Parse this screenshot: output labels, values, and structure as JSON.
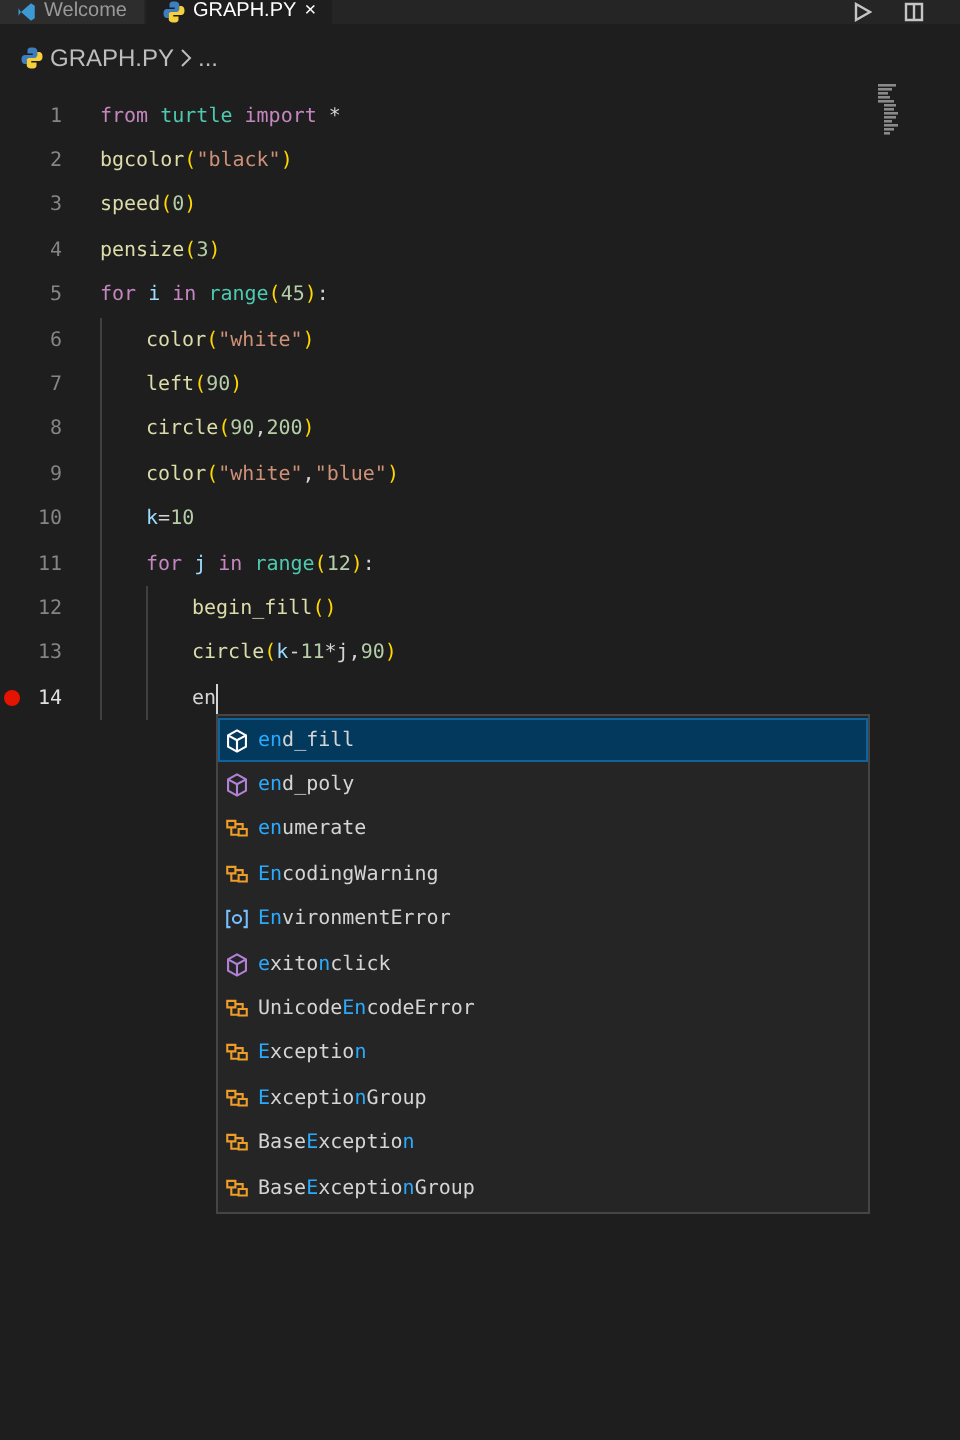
{
  "tabs": [
    {
      "label": "Welcome",
      "selected": false,
      "kind": "welcome"
    },
    {
      "label": "GRAPH.PY",
      "selected": true,
      "kind": "python",
      "close": "×"
    }
  ],
  "breadcrumb": {
    "file": "GRAPH.PY",
    "rest": "..."
  },
  "editor": {
    "lines": [
      {
        "number": "1",
        "breakpoint": false,
        "current": false,
        "tokens": [
          {
            "text": "from",
            "kind": "keyword"
          },
          {
            "text": " turtle",
            "kind": "module"
          },
          {
            "text": " import",
            "kind": "keyword"
          },
          {
            "text": " *",
            "kind": "plain"
          }
        ]
      },
      {
        "number": "2",
        "breakpoint": false,
        "current": false,
        "tokens": [
          {
            "text": "bgcolor",
            "kind": "function"
          },
          {
            "text": "(",
            "kind": "bracket"
          },
          {
            "text": "\"black\"",
            "kind": "string"
          },
          {
            "text": ")",
            "kind": "bracket"
          }
        ]
      },
      {
        "number": "3",
        "breakpoint": false,
        "current": false,
        "tokens": [
          {
            "text": "speed",
            "kind": "function"
          },
          {
            "text": "(",
            "kind": "bracket"
          },
          {
            "text": "0",
            "kind": "number"
          },
          {
            "text": ")",
            "kind": "bracket"
          }
        ]
      },
      {
        "number": "4",
        "breakpoint": false,
        "current": false,
        "tokens": [
          {
            "text": "pensize",
            "kind": "function"
          },
          {
            "text": "(",
            "kind": "bracket"
          },
          {
            "text": "3",
            "kind": "number"
          },
          {
            "text": ")",
            "kind": "bracket"
          }
        ]
      },
      {
        "number": "5",
        "breakpoint": false,
        "current": false,
        "tokens": [
          {
            "text": "for",
            "kind": "keyword"
          },
          {
            "text": " i",
            "kind": "variable"
          },
          {
            "text": " in",
            "kind": "keyword"
          },
          {
            "text": " range",
            "kind": "module"
          },
          {
            "text": "(",
            "kind": "bracket"
          },
          {
            "text": "45",
            "kind": "number"
          },
          {
            "text": ")",
            "kind": "bracket"
          },
          {
            "text": ":",
            "kind": "plain"
          }
        ],
        "children": [
          {
            "number": "6",
            "breakpoint": false,
            "current": false,
            "tokens": [
              {
                "text": "color",
                "kind": "function"
              },
              {
                "text": "(",
                "kind": "bracket"
              },
              {
                "text": "\"white\"",
                "kind": "string"
              },
              {
                "text": ")",
                "kind": "bracket"
              }
            ]
          },
          {
            "number": "7",
            "breakpoint": false,
            "current": false,
            "tokens": [
              {
                "text": "left",
                "kind": "function"
              },
              {
                "text": "(",
                "kind": "bracket"
              },
              {
                "text": "90",
                "kind": "number"
              },
              {
                "text": ")",
                "kind": "bracket"
              }
            ]
          },
          {
            "number": "8",
            "breakpoint": false,
            "current": false,
            "tokens": [
              {
                "text": "circle",
                "kind": "function"
              },
              {
                "text": "(",
                "kind": "bracket"
              },
              {
                "text": "90",
                "kind": "number"
              },
              {
                "text": ",",
                "kind": "plain"
              },
              {
                "text": "200",
                "kind": "number"
              },
              {
                "text": ")",
                "kind": "bracket"
              }
            ]
          },
          {
            "number": "9",
            "breakpoint": false,
            "current": false,
            "tokens": [
              {
                "text": "color",
                "kind": "function"
              },
              {
                "text": "(",
                "kind": "bracket"
              },
              {
                "text": "\"white\"",
                "kind": "string"
              },
              {
                "text": ",",
                "kind": "plain"
              },
              {
                "text": "\"blue\"",
                "kind": "string"
              },
              {
                "text": ")",
                "kind": "bracket"
              }
            ]
          },
          {
            "number": "10",
            "breakpoint": false,
            "current": false,
            "tokens": [
              {
                "text": "k",
                "kind": "variable"
              },
              {
                "text": "=",
                "kind": "plain"
              },
              {
                "text": "10",
                "kind": "number"
              }
            ]
          },
          {
            "number": "11",
            "breakpoint": false,
            "current": false,
            "tokens": [
              {
                "text": "for",
                "kind": "keyword"
              },
              {
                "text": " j",
                "kind": "variable"
              },
              {
                "text": " in",
                "kind": "keyword"
              },
              {
                "text": " range",
                "kind": "module"
              },
              {
                "text": "(",
                "kind": "bracket"
              },
              {
                "text": "12",
                "kind": "number"
              },
              {
                "text": ")",
                "kind": "bracket"
              },
              {
                "text": ":",
                "kind": "plain"
              }
            ],
            "children": [
              {
                "number": "12",
                "breakpoint": false,
                "current": false,
                "tokens": [
                  {
                    "text": "begin_fill",
                    "kind": "function"
                  },
                  {
                    "text": "()",
                    "kind": "bracket"
                  }
                ]
              },
              {
                "number": "13",
                "breakpoint": false,
                "current": false,
                "tokens": [
                  {
                    "text": "circle",
                    "kind": "function"
                  },
                  {
                    "text": "(",
                    "kind": "bracket"
                  },
                  {
                    "text": "k",
                    "kind": "variable"
                  },
                  {
                    "text": "-",
                    "kind": "plain"
                  },
                  {
                    "text": "11",
                    "kind": "number"
                  },
                  {
                    "text": "*j,",
                    "kind": "plain"
                  },
                  {
                    "text": "90",
                    "kind": "number"
                  },
                  {
                    "text": ")",
                    "kind": "bracket"
                  }
                ]
              },
              {
                "number": "14",
                "breakpoint": true,
                "current": true,
                "tokens": [
                  {
                    "text": "en",
                    "kind": "plain"
                  }
                ]
              }
            ]
          }
        ]
      }
    ]
  },
  "suggestions": [
    {
      "kind": "method",
      "selected": true,
      "label": "**en**d_fill"
    },
    {
      "kind": "method",
      "selected": false,
      "label": "**en**d_poly"
    },
    {
      "kind": "class",
      "selected": false,
      "label": "**en**umerate"
    },
    {
      "kind": "class",
      "selected": false,
      "label": "**En**codingWarning"
    },
    {
      "kind": "variable",
      "selected": false,
      "label": "**En**vironmentError"
    },
    {
      "kind": "method",
      "selected": false,
      "label": "**e**xito**n**click"
    },
    {
      "kind": "class",
      "selected": false,
      "label": "Unicode**En**codeError"
    },
    {
      "kind": "class",
      "selected": false,
      "label": "**E**xceptio**n**"
    },
    {
      "kind": "class",
      "selected": false,
      "label": "**E**xceptio**n**Group"
    },
    {
      "kind": "class",
      "selected": false,
      "label": "Base**E**xceptio**n**"
    },
    {
      "kind": "class",
      "selected": false,
      "label": "Base**E**xceptio**n**Group"
    }
  ]
}
